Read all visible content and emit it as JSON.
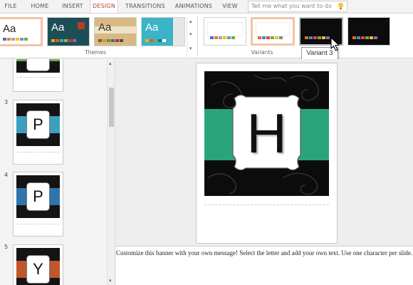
{
  "ribbon": {
    "tabs": [
      {
        "label": "FILE",
        "active": false
      },
      {
        "label": "HOME",
        "active": false
      },
      {
        "label": "INSERT",
        "active": false
      },
      {
        "label": "DESIGN",
        "active": true
      },
      {
        "label": "TRANSITIONS",
        "active": false
      },
      {
        "label": "ANIMATIONS",
        "active": false
      },
      {
        "label": "VIEW",
        "active": false
      }
    ],
    "tell_me_placeholder": "Tell me what you want to do",
    "themes_label": "Themes",
    "variants_label": "Variants",
    "theme_sample_text": "Aa",
    "tooltip": "Variant 3"
  },
  "slides_pane": {
    "slides": [
      {
        "number": "",
        "letter": "",
        "band_color": "#6aa84f"
      },
      {
        "number": "3",
        "letter": "P",
        "band_color": "#3aa0bf"
      },
      {
        "number": "4",
        "letter": "P",
        "band_color": "#2f74ad"
      },
      {
        "number": "5",
        "letter": "Y",
        "band_color": "#c2562b"
      }
    ]
  },
  "current_slide": {
    "letter": "H",
    "band_color": "#2aa57b"
  },
  "notes": {
    "text": "Customize this banner with your own message! Select the letter and add your own text. Use one character per slide."
  },
  "colors": {
    "accent": "#b7472a",
    "selection_border": "#f2c3a8"
  }
}
